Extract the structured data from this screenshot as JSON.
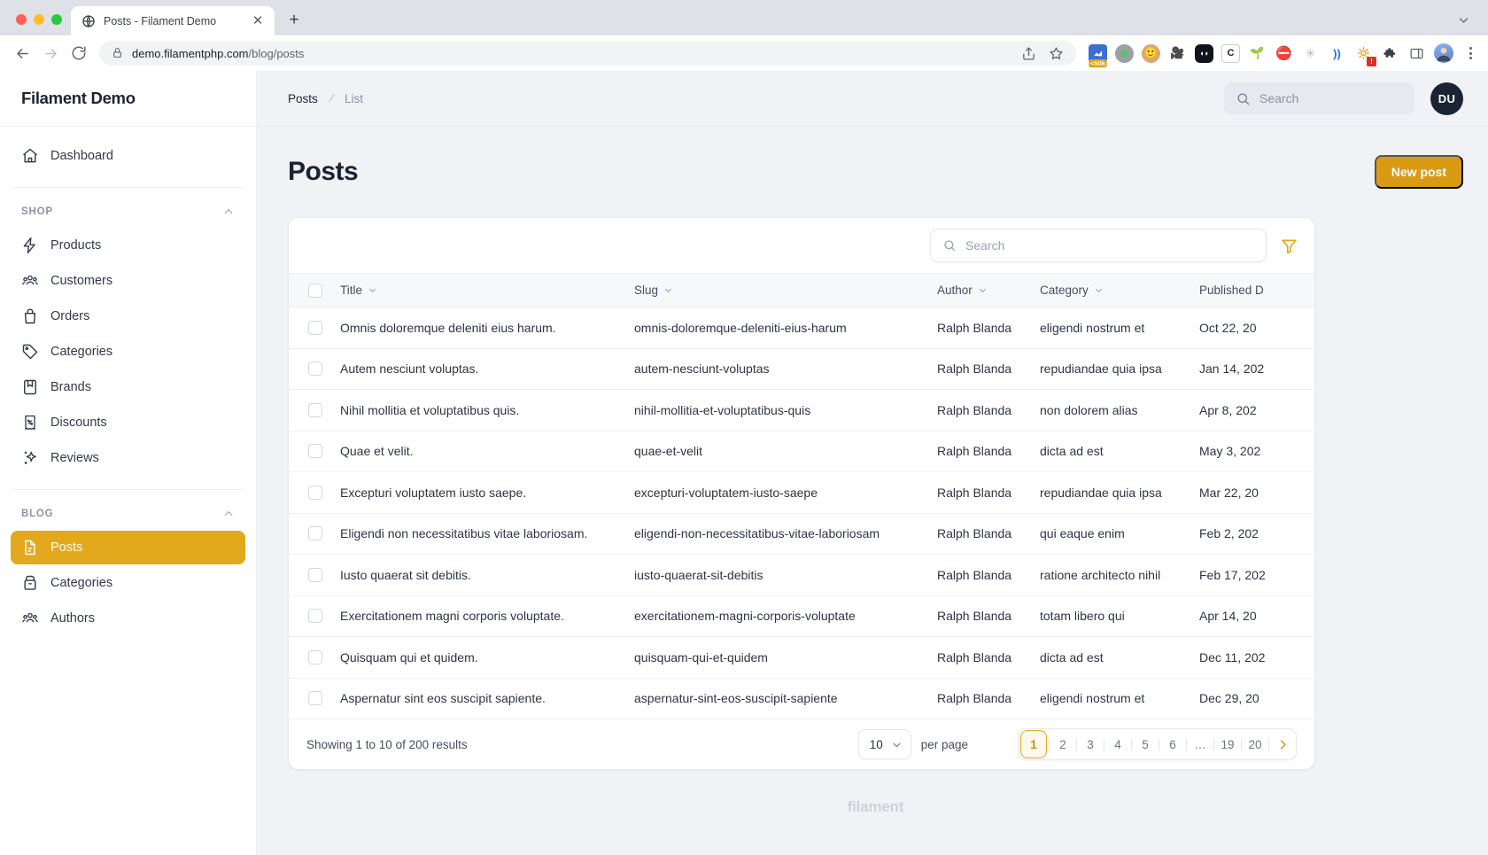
{
  "browser": {
    "tab": {
      "title": "Posts - Filament Demo",
      "favicon_icon": "globe-icon",
      "close_icon": "close-icon"
    },
    "new_tab_icon": "plus-icon",
    "window_controls": [
      "close",
      "minimize",
      "maximize"
    ],
    "back_icon": "arrow-left-icon",
    "forward_icon": "arrow-right-icon",
    "reload_icon": "reload-icon",
    "lock_icon": "lock-icon",
    "url": "demo.filamentphp.com",
    "url_path": "/blog/posts",
    "share_icon": "share-icon",
    "bookmark_icon": "star-icon",
    "extensions": [
      {
        "name": "analytics-extension",
        "glyph": "📊",
        "badge": "<50k"
      },
      {
        "name": "circle-extension",
        "glyph": "●",
        "badge": ""
      },
      {
        "name": "face-extension",
        "glyph": "🧑",
        "badge": ""
      },
      {
        "name": "camera-extension",
        "glyph": "📹",
        "badge": ""
      },
      {
        "name": "dark-logo-extension",
        "glyph": "◖◗",
        "badge": ""
      },
      {
        "name": "c-extension",
        "glyph": "C",
        "badge": ""
      },
      {
        "name": "sprout-extension",
        "glyph": "🌱",
        "badge": ""
      },
      {
        "name": "stop-extension",
        "glyph": "✋",
        "badge": ""
      },
      {
        "name": "web-extension",
        "glyph": "✳",
        "badge": ""
      },
      {
        "name": "wifi-extension",
        "glyph": "))",
        "badge": ""
      },
      {
        "name": "alert-extension",
        "glyph": "🔆",
        "badge": "!"
      },
      {
        "name": "puzzle-extensions-icon",
        "glyph": "🧩",
        "badge": ""
      }
    ],
    "sidepanel_icon": "sidepanel-icon",
    "profile_icon": "profile-avatar",
    "menu_icon": "kebab-menu-icon",
    "window_chevron_icon": "chevron-down-icon"
  },
  "sidebar": {
    "brand": "Filament Demo",
    "dashboard": {
      "label": "Dashboard",
      "icon": "home-icon"
    },
    "groups": [
      {
        "label": "SHOP",
        "collapse_icon": "chevron-up-icon",
        "items": [
          {
            "label": "Products",
            "icon": "bolt-icon",
            "active": false
          },
          {
            "label": "Customers",
            "icon": "users-icon",
            "active": false
          },
          {
            "label": "Orders",
            "icon": "bag-icon",
            "active": false
          },
          {
            "label": "Categories",
            "icon": "tag-icon",
            "active": false
          },
          {
            "label": "Brands",
            "icon": "bookmark-icon",
            "active": false
          },
          {
            "label": "Discounts",
            "icon": "receipt-percent-icon",
            "active": false
          },
          {
            "label": "Reviews",
            "icon": "sparkles-icon",
            "active": false
          }
        ]
      },
      {
        "label": "BLOG",
        "collapse_icon": "chevron-up-icon",
        "items": [
          {
            "label": "Posts",
            "icon": "document-icon",
            "active": true
          },
          {
            "label": "Categories",
            "icon": "archive-icon",
            "active": false
          },
          {
            "label": "Authors",
            "icon": "users-icon",
            "active": false
          }
        ]
      }
    ]
  },
  "topbar": {
    "breadcrumbs": [
      {
        "label": "Posts",
        "current": false
      },
      {
        "label": "List",
        "current": true
      }
    ],
    "search": {
      "placeholder": "Search",
      "icon": "search-icon"
    },
    "user_initials": "DU"
  },
  "main": {
    "title": "Posts",
    "new_button": "New post"
  },
  "table": {
    "search": {
      "placeholder": "Search",
      "icon": "search-icon"
    },
    "filter_icon": "funnel-icon",
    "columns": [
      {
        "key": "title",
        "label": "Title",
        "sortable": true
      },
      {
        "key": "slug",
        "label": "Slug",
        "sortable": true
      },
      {
        "key": "author",
        "label": "Author",
        "sortable": true
      },
      {
        "key": "cat",
        "label": "Category",
        "sortable": true
      },
      {
        "key": "date",
        "label": "Published D",
        "sortable": false
      }
    ],
    "rows": [
      {
        "title": "Omnis doloremque deleniti eius harum.",
        "slug": "omnis-doloremque-deleniti-eius-harum",
        "author": "Ralph Blanda",
        "cat": "eligendi nostrum et",
        "date": "Oct 22, 20"
      },
      {
        "title": "Autem nesciunt voluptas.",
        "slug": "autem-nesciunt-voluptas",
        "author": "Ralph Blanda",
        "cat": "repudiandae quia ipsa",
        "date": "Jan 14, 202"
      },
      {
        "title": "Nihil mollitia et voluptatibus quis.",
        "slug": "nihil-mollitia-et-voluptatibus-quis",
        "author": "Ralph Blanda",
        "cat": "non dolorem alias",
        "date": "Apr 8, 202"
      },
      {
        "title": "Quae et velit.",
        "slug": "quae-et-velit",
        "author": "Ralph Blanda",
        "cat": "dicta ad est",
        "date": "May 3, 202"
      },
      {
        "title": "Excepturi voluptatem iusto saepe.",
        "slug": "excepturi-voluptatem-iusto-saepe",
        "author": "Ralph Blanda",
        "cat": "repudiandae quia ipsa",
        "date": "Mar 22, 20"
      },
      {
        "title": "Eligendi non necessitatibus vitae laboriosam.",
        "slug": "eligendi-non-necessitatibus-vitae-laboriosam",
        "author": "Ralph Blanda",
        "cat": "qui eaque enim",
        "date": "Feb 2, 202"
      },
      {
        "title": "Iusto quaerat sit debitis.",
        "slug": "iusto-quaerat-sit-debitis",
        "author": "Ralph Blanda",
        "cat": "ratione architecto nihil",
        "date": "Feb 17, 202"
      },
      {
        "title": "Exercitationem magni corporis voluptate.",
        "slug": "exercitationem-magni-corporis-voluptate",
        "author": "Ralph Blanda",
        "cat": "totam libero qui",
        "date": "Apr 14, 20"
      },
      {
        "title": "Quisquam qui et quidem.",
        "slug": "quisquam-qui-et-quidem",
        "author": "Ralph Blanda",
        "cat": "dicta ad est",
        "date": "Dec 11, 202"
      },
      {
        "title": "Aspernatur sint eos suscipit sapiente.",
        "slug": "aspernatur-sint-eos-suscipit-sapiente",
        "author": "Ralph Blanda",
        "cat": "eligendi nostrum et",
        "date": "Dec 29, 20"
      }
    ],
    "footer": {
      "showing": "Showing 1 to 10 of 200 results",
      "per_page_value": "10",
      "per_page_label": "per page",
      "pages": [
        "1",
        "2",
        "3",
        "4",
        "5",
        "6",
        "…",
        "19",
        "20"
      ],
      "active_page": "1",
      "next_icon": "chevron-right-icon"
    }
  },
  "footer_brand": "filament",
  "colors": {
    "accent": "#e3a81b",
    "accent_dark": "#d99a14",
    "sidebar_bg": "#ffffff",
    "page_bg": "#f1f2f6",
    "text": "#1c2434"
  }
}
